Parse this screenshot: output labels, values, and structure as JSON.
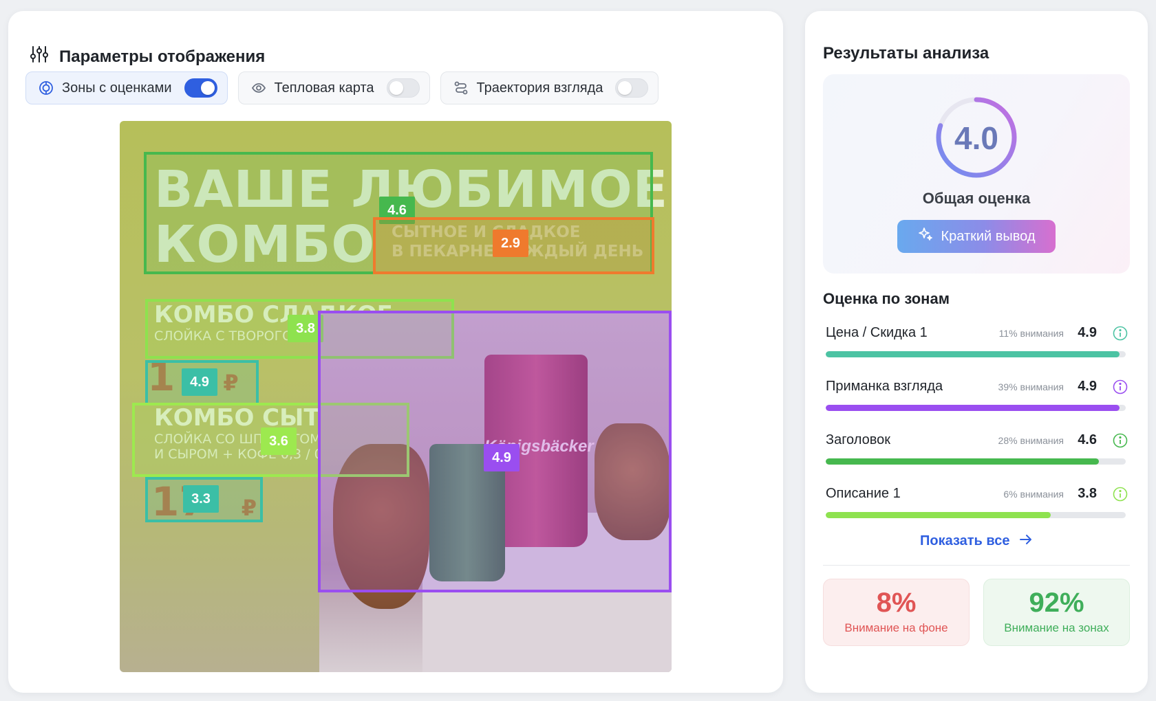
{
  "left_panel": {
    "title": "Параметры отображения",
    "toggles": [
      {
        "label": "Зоны с оценками",
        "state": "on"
      },
      {
        "label": "Тепловая карта",
        "state": "off"
      },
      {
        "label": "Траектория взгляда",
        "state": "off"
      }
    ]
  },
  "poster": {
    "headline_line1": "ВАШЕ ЛЮБИМОЕ",
    "headline_line2": "КОМБО",
    "subhead_line1": "СЫТНОЕ И СЛАДКОЕ",
    "subhead_line2": "В ПЕКАРНЕ КАЖДЫЙ ДЕНЬ",
    "combo1_title": "КОМБО СЛАДКОЕ",
    "combo1_desc": "СЛОЙКА С ТВОРОГОМ + КОФЕ 0,3 / 0,4",
    "combo1_price": "1",
    "combo2_title": "КОМБО СЫТНОЕ",
    "combo2_desc_line1": "СЛОЙКА СО ШПИНАТОМ, ЯЙЦОМ",
    "combo2_desc_line2": "И СЫРОМ + КОФЕ 0,3 / 0,4",
    "combo2_price": "17",
    "currency": "₽",
    "brand": "Königsbäcker",
    "zones": [
      {
        "id": "headline",
        "score": "4.6",
        "color": "#46b84e"
      },
      {
        "id": "subhead",
        "score": "2.9",
        "color": "#ef7a2d"
      },
      {
        "id": "combo1",
        "score": "3.8",
        "color": "#8ee24f"
      },
      {
        "id": "price1",
        "score": "4.9",
        "color": "#3bbfa6"
      },
      {
        "id": "combo2",
        "score": "3.6",
        "color": "#9de94f"
      },
      {
        "id": "price2",
        "score": "3.3",
        "color": "#3bbfa6"
      },
      {
        "id": "photo",
        "score": "4.9",
        "color": "#9a4ef0"
      }
    ]
  },
  "right_panel": {
    "title": "Результаты анализа",
    "overall_score": "4.0",
    "overall_fraction": 0.8,
    "overall_label": "Общая оценка",
    "summary_button": "Краткий вывод",
    "zones_title": "Оценка по зонам",
    "zone_scores": [
      {
        "name": "Цена / Скидка 1",
        "attention": "11% внимания",
        "score": "4.9",
        "fill": 0.98,
        "color": "#4cc3a3",
        "icon_color": "#4cc3a3"
      },
      {
        "name": "Приманка взгляда",
        "attention": "39% внимания",
        "score": "4.9",
        "fill": 0.98,
        "color": "#9a4ef0",
        "icon_color": "#9a4ef0"
      },
      {
        "name": "Заголовок",
        "attention": "28% внимания",
        "score": "4.6",
        "fill": 0.91,
        "color": "#46b84e",
        "icon_color": "#46b84e"
      },
      {
        "name": "Описание 1",
        "attention": "6% внимания",
        "score": "3.8",
        "fill": 0.75,
        "color": "#8ee24f",
        "icon_color": "#8ee24f"
      }
    ],
    "show_all": "Показать все",
    "stats": [
      {
        "value": "8%",
        "label": "Внимание на фоне"
      },
      {
        "value": "92%",
        "label": "Внимание на зонах"
      }
    ]
  }
}
